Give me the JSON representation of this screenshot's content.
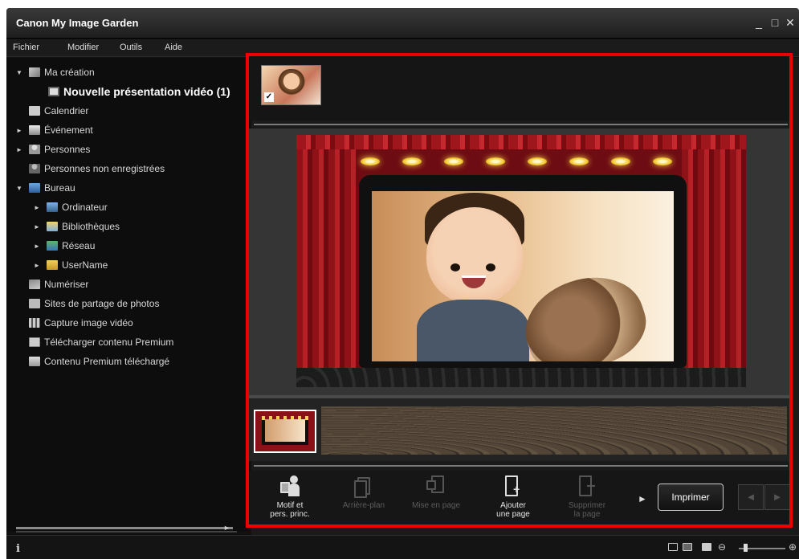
{
  "window": {
    "title": "Canon My Image Garden",
    "controls": [
      "_",
      "□",
      "✕"
    ]
  },
  "menubar": [
    "Fichier",
    "Modifier",
    "Outils",
    "Aide"
  ],
  "sidebar": {
    "items": [
      {
        "label": "Ma création",
        "expander": "▼",
        "icon": "creation-icon"
      },
      {
        "label": "Nouvelle présentation vidéo (1)",
        "icon": "slideshow-icon"
      },
      {
        "label": "Calendrier",
        "icon": "calendar-icon"
      },
      {
        "label": "Événement",
        "expander": "►",
        "icon": "event-icon"
      },
      {
        "label": "Personnes",
        "expander": "►",
        "icon": "people-icon"
      },
      {
        "label": "Personnes non enregistrées",
        "icon": "unregistered-people-icon"
      },
      {
        "label": "Bureau",
        "expander": "▼",
        "icon": "desktop-icon"
      },
      {
        "label": "Ordinateur",
        "expander": "►",
        "icon": "computer-icon"
      },
      {
        "label": "Bibliothèques",
        "expander": "►",
        "icon": "libraries-icon"
      },
      {
        "label": "Réseau",
        "expander": "►",
        "icon": "network-icon"
      },
      {
        "label": "UserName",
        "expander": "►",
        "icon": "user-folder-icon"
      },
      {
        "label": "Numériser",
        "icon": "scan-icon"
      },
      {
        "label": "Sites de partage de photos",
        "icon": "photo-sharing-icon"
      },
      {
        "label": "Capture image vidéo",
        "icon": "video-capture-icon"
      },
      {
        "label": "Télécharger contenu Premium",
        "icon": "download-premium-icon"
      },
      {
        "label": "Contenu Premium téléchargé",
        "icon": "premium-folder-icon"
      }
    ]
  },
  "toolbar": {
    "buttons": [
      {
        "label1": "Motif et",
        "label2": "pers. princ.",
        "enabled": true
      },
      {
        "label1": "Arrière-plan",
        "label2": "",
        "enabled": false
      },
      {
        "label1": "Mise en page",
        "label2": "",
        "enabled": false
      },
      {
        "label1": "Ajouter",
        "label2": "une page",
        "enabled": true
      },
      {
        "label1": "Supprimer",
        "label2": "la page",
        "enabled": false
      }
    ],
    "print_label": "Imprimer",
    "more_arrow": "►",
    "prev_arrow": "◄",
    "next_arrow": "►"
  },
  "status": {
    "info_icon": "i",
    "zoom_minus": "⊖",
    "zoom_plus": "⊕"
  },
  "colors": {
    "highlight_frame": "#e00000",
    "app_bg": "#111111"
  }
}
